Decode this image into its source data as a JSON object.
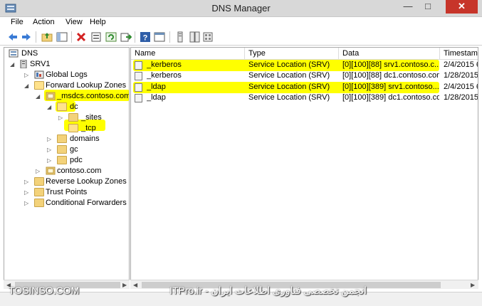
{
  "window": {
    "title": "DNS Manager",
    "minimize": "—",
    "maximize": "□",
    "close": "✕"
  },
  "menu": [
    "File",
    "Action",
    "View",
    "Help"
  ],
  "toolbar_icons": [
    "back-arrow-icon",
    "forward-arrow-icon",
    "up-folder-icon",
    "show-hide-tree-icon",
    "delete-icon",
    "properties-icon",
    "refresh-icon",
    "export-list-icon",
    "help-icon",
    "console-icon",
    "new-record-icon",
    "new-domain-icon"
  ],
  "tree": {
    "dns": "DNS",
    "server": "SRV1",
    "global_logs": "Global Logs",
    "forward_zones": "Forward Lookup Zones",
    "msdcs": "_msdcs.contoso.com",
    "dc": "dc",
    "sites": "_sites",
    "tcp": "_tcp",
    "domains": "domains",
    "gc": "gc",
    "pdc": "pdc",
    "contoso": "contoso.com",
    "reverse_zones": "Reverse Lookup Zones",
    "trust_points": "Trust Points",
    "conditional_forwarders": "Conditional Forwarders"
  },
  "list": {
    "columns": {
      "name": "Name",
      "type": "Type",
      "data": "Data",
      "timestamp": "Timestam"
    },
    "rows": [
      {
        "name": "_kerberos",
        "type": "Service Location (SRV)",
        "data": "[0][100][88] srv1.contoso.c...",
        "timestamp": "2/4/2015 6",
        "highlighted": true
      },
      {
        "name": "_kerberos",
        "type": "Service Location (SRV)",
        "data": "[0][100][88] dc1.contoso.com.",
        "timestamp": "1/28/2015 6",
        "highlighted": false
      },
      {
        "name": "_ldap",
        "type": "Service Location (SRV)",
        "data": "[0][100][389] srv1.contoso....",
        "timestamp": "2/4/2015 6",
        "highlighted": true
      },
      {
        "name": "_ldap",
        "type": "Service Location (SRV)",
        "data": "[0][100][389] dc1.contoso.com.",
        "timestamp": "1/28/2015 6",
        "highlighted": false
      }
    ]
  },
  "watermark": {
    "left": "TOSINSO.COM",
    "right": "انجمن تخصصی فناوری اطلاعات ایران - ITPro.ir"
  },
  "highlight_color": "#ffff00",
  "close_color": "#c7352a"
}
